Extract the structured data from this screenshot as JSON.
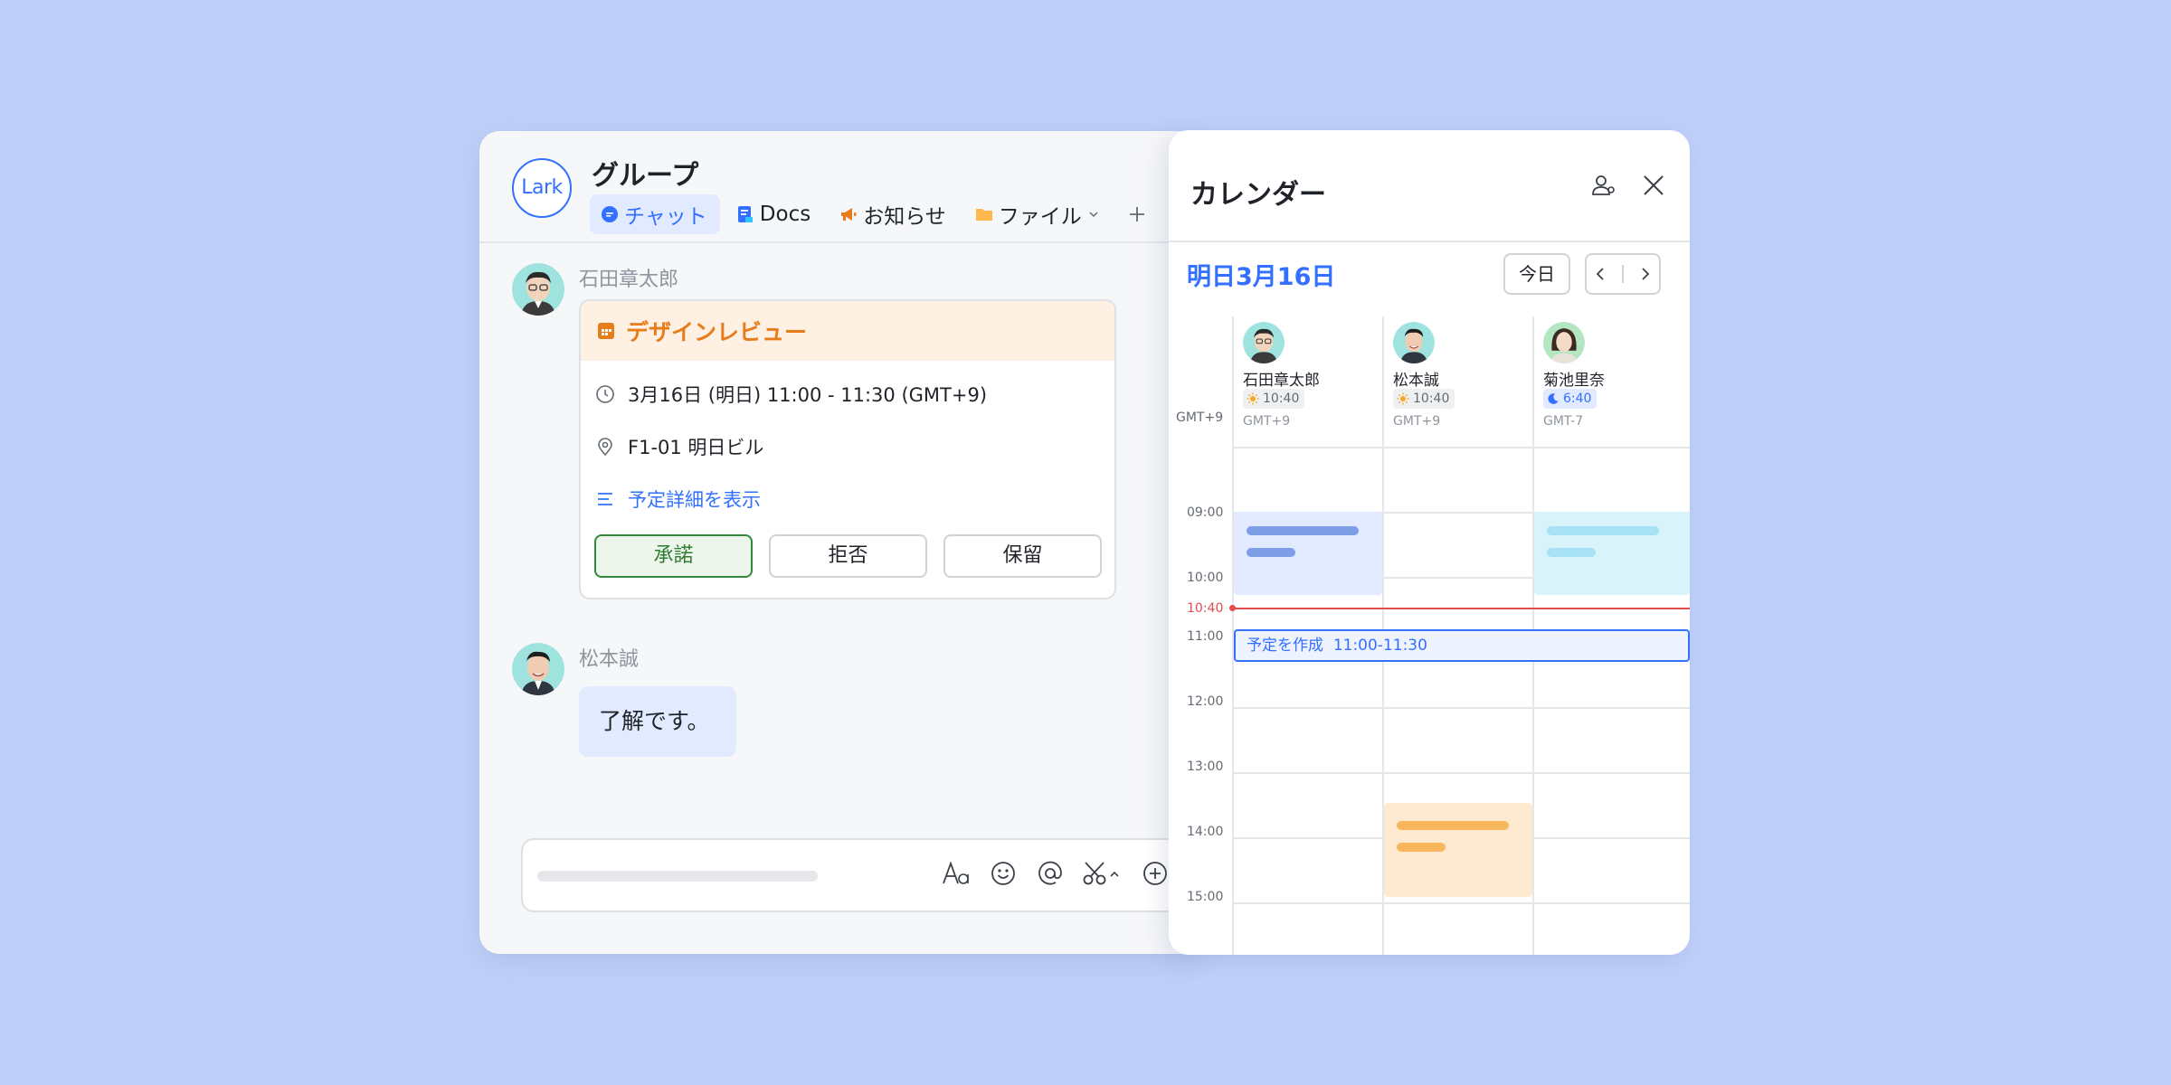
{
  "chat": {
    "logo": "Lark",
    "group_title": "グループ",
    "tabs": [
      {
        "label": "チャット",
        "icon": "chat-bubble-icon"
      },
      {
        "label": "Docs",
        "icon": "docs-icon"
      },
      {
        "label": "お知らせ",
        "icon": "megaphone-icon"
      },
      {
        "label": "ファイル",
        "icon": "folder-icon"
      }
    ],
    "messages": [
      {
        "sender": "石田章太郎"
      },
      {
        "sender": "松本誠",
        "text": "了解です。"
      }
    ],
    "event_card": {
      "title": "デザインレビュー",
      "time": "3月16日 (明日) 11:00 - 11:30 (GMT+9)",
      "location": "F1-01 明日ビル",
      "details_link": "予定詳細を表示",
      "buttons": {
        "accept": "承諾",
        "decline": "拒否",
        "tentative": "保留"
      }
    }
  },
  "calendar": {
    "title": "カレンダー",
    "date": "明日3月16日",
    "today_button": "今日",
    "timezone": "GMT+9",
    "people": [
      {
        "name": "石田章太郎",
        "local_time": "10:40",
        "tz": "GMT+9",
        "period": "day"
      },
      {
        "name": "松本誠",
        "local_time": "10:40",
        "tz": "GMT+9",
        "period": "day"
      },
      {
        "name": "菊池里奈",
        "local_time": "6:40",
        "tz": "GMT-7",
        "period": "night"
      }
    ],
    "hours": [
      "09:00",
      "10:00",
      "11:00",
      "12:00",
      "13:00",
      "14:00",
      "15:00"
    ],
    "now_label": "10:40",
    "new_event": {
      "label": "予定を作成",
      "time": "11:00-11:30"
    }
  },
  "colors": {
    "accent": "#3370ff",
    "event_orange": "#e77d1a",
    "now_line": "#e24c4c",
    "background": "#bfd0f8"
  }
}
